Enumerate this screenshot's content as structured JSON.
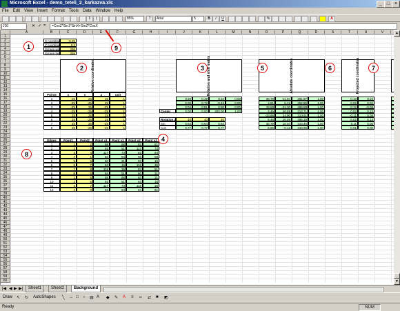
{
  "window": {
    "title": "Microsoft Excel - demo_teteli_2_karkazva.xls"
  },
  "menu": [
    "File",
    "Edit",
    "View",
    "Insert",
    "Format",
    "Tools",
    "Data",
    "Window",
    "Help"
  ],
  "toolbar": {
    "zoom": "85%",
    "font": "Arial",
    "size": "5"
  },
  "formula_bar": {
    "cell": "J10",
    "formula": "=CosZ*Sin1*SinX+SinZ*CosX"
  },
  "columns": [
    "A",
    "B",
    "C",
    "D",
    "E",
    "F",
    "G",
    "H",
    "I",
    "J",
    "K",
    "L",
    "M",
    "N",
    "O",
    "P",
    "Q",
    "R",
    "S",
    "T",
    "U",
    "V",
    "W",
    "X"
  ],
  "rows": [
    "1",
    "2",
    "3",
    "4",
    "5",
    "6",
    "7",
    "8",
    "9",
    "10",
    "11",
    "12",
    "13",
    "14",
    "15",
    "16",
    "17",
    "18",
    "19",
    "20",
    "21",
    "22",
    "23",
    "24",
    "25",
    "26",
    "27",
    "28",
    "29",
    "30",
    "31",
    "32",
    "33",
    "34",
    "35",
    "36",
    "37",
    "38",
    "39",
    "40",
    "41",
    "42",
    "43",
    "44",
    "45",
    "46",
    "47",
    "48",
    "49",
    "50",
    "51",
    "52",
    "53",
    "54",
    "55",
    "56",
    "57",
    "58",
    "59",
    "60"
  ],
  "params": [
    {
      "label": "X coordinate of TL point",
      "value": "-0,35"
    },
    {
      "label": "Y coordinate of TL point",
      "value": "0,2"
    },
    {
      "label": "Screen width",
      "value": "256"
    },
    {
      "label": "Screen height",
      "value": "256"
    }
  ],
  "headers": {
    "rel": "Relative coordinates",
    "rot": "Rotation and shift matrix",
    "abs": "Absolute coordinates",
    "proj": "Projected coordinates",
    "scr": "Screen coordinates"
  },
  "points": {
    "header": [
      "Points",
      "x",
      "y",
      "z",
      "unit"
    ],
    "rows": [
      [
        "1",
        "-25",
        "25",
        "25",
        "1"
      ],
      [
        "2",
        "-25",
        "-25",
        "25",
        "1"
      ],
      [
        "3",
        "-25",
        "25",
        "-25",
        "1"
      ],
      [
        "4",
        "-25",
        "-25",
        "-25",
        "1"
      ],
      [
        "5",
        "25",
        "25",
        "25",
        "1"
      ],
      [
        "6",
        "25",
        "-25",
        "25",
        "1"
      ],
      [
        "7",
        "25",
        "25",
        "-25",
        "1"
      ],
      [
        "8",
        "25",
        "-25",
        "-25",
        "1"
      ]
    ]
  },
  "matrix": [
    [
      "0,69",
      "-0,49",
      "0,64",
      "0,00"
    ],
    [
      "0,00",
      "0,72",
      "-0,49",
      "0,00"
    ],
    [
      "0,04",
      "0,81",
      "0,50",
      "0,00"
    ],
    [
      "0,00",
      "0,00",
      "300,00",
      "1,00"
    ]
  ],
  "center_label": "Center",
  "rotation": {
    "title": "Rotation angles",
    "angles": [
      "40",
      "40",
      "40"
    ],
    "sin_label": "Sin",
    "sin": [
      "0,64",
      "0,64",
      "0,64"
    ],
    "cos_label": "Cos",
    "cos": [
      "0,77",
      "0,77",
      "0,77"
    ]
  },
  "absolute": [
    [
      "35,79",
      "-11,94",
      "281,87",
      "1,00"
    ],
    [
      "4,81",
      "6,12",
      "252,85",
      "1,00"
    ],
    [
      "33,89",
      "-24,30",
      "289,89",
      "1,00"
    ],
    [
      "4,46",
      "40,59",
      "313,71",
      "1,00"
    ],
    [
      "-33,86",
      "24,90",
      "310,91",
      "1,00"
    ],
    [
      "6,46",
      "40,59",
      "286,39",
      "1,00"
    ],
    [
      "35,79",
      "15,04",
      "310,45",
      "1,00"
    ],
    [
      "-4,85",
      "-0,12",
      "340,95",
      "1,00"
    ]
  ],
  "projected": [
    [
      "0,13",
      "0,04"
    ],
    [
      "0,02",
      "0,02"
    ],
    [
      "0,12",
      "-0,08"
    ],
    [
      "0,02",
      "0,13"
    ],
    [
      "-0,11",
      "0,08"
    ],
    [
      "0,02",
      "0,14"
    ],
    [
      "0,11",
      "0,05"
    ],
    [
      "-0,01",
      "0,00"
    ]
  ],
  "screen": [
    [
      "56",
      "65"
    ],
    [
      "92",
      "57"
    ],
    [
      "117",
      "73"
    ],
    [
      "82",
      "84"
    ],
    [
      "90",
      "37"
    ],
    [
      "92",
      "15"
    ],
    [
      "116",
      "43"
    ],
    [
      "84",
      "57"
    ]
  ],
  "edges": {
    "header": [
      "Edges",
      "Point1",
      "Point2",
      "Point x1",
      "Point y1",
      "Point x2",
      "Point y2"
    ],
    "rows": [
      [
        "1",
        "1",
        "2",
        "66",
        "68",
        "92",
        "61"
      ],
      [
        "2",
        "2",
        "3",
        "92",
        "51",
        "117",
        "73"
      ],
      [
        "3",
        "3",
        "4",
        "117",
        "73",
        "82",
        "84"
      ],
      [
        "4",
        "4",
        "1",
        "82",
        "84",
        "56",
        "68"
      ],
      [
        "5",
        "5",
        "6",
        "60",
        "31",
        "93",
        "15"
      ],
      [
        "6",
        "6",
        "7",
        "93",
        "15",
        "116",
        "36"
      ],
      [
        "7",
        "7",
        "8",
        "116",
        "36",
        "84",
        "51"
      ],
      [
        "8",
        "8",
        "5",
        "84",
        "51",
        "60",
        "31"
      ],
      [
        "9",
        "1",
        "5",
        "56",
        "68",
        "60",
        "31"
      ],
      [
        "10",
        "2",
        "6",
        "92",
        "51",
        "93",
        "15"
      ],
      [
        "11",
        "3",
        "7",
        "117",
        "73",
        "116",
        "36"
      ],
      [
        "12",
        "4",
        "8",
        "82",
        "84",
        "84",
        "51"
      ]
    ]
  },
  "markers": [
    "1",
    "2",
    "3",
    "4",
    "5",
    "6",
    "7",
    "8",
    "9"
  ],
  "tabs": [
    "Sheet1",
    "Sheet2",
    "Background"
  ],
  "draw": {
    "draw_label": "Draw",
    "autoshapes_label": "AutoShapes"
  },
  "status": {
    "left": "Ready",
    "num": "NUM"
  }
}
